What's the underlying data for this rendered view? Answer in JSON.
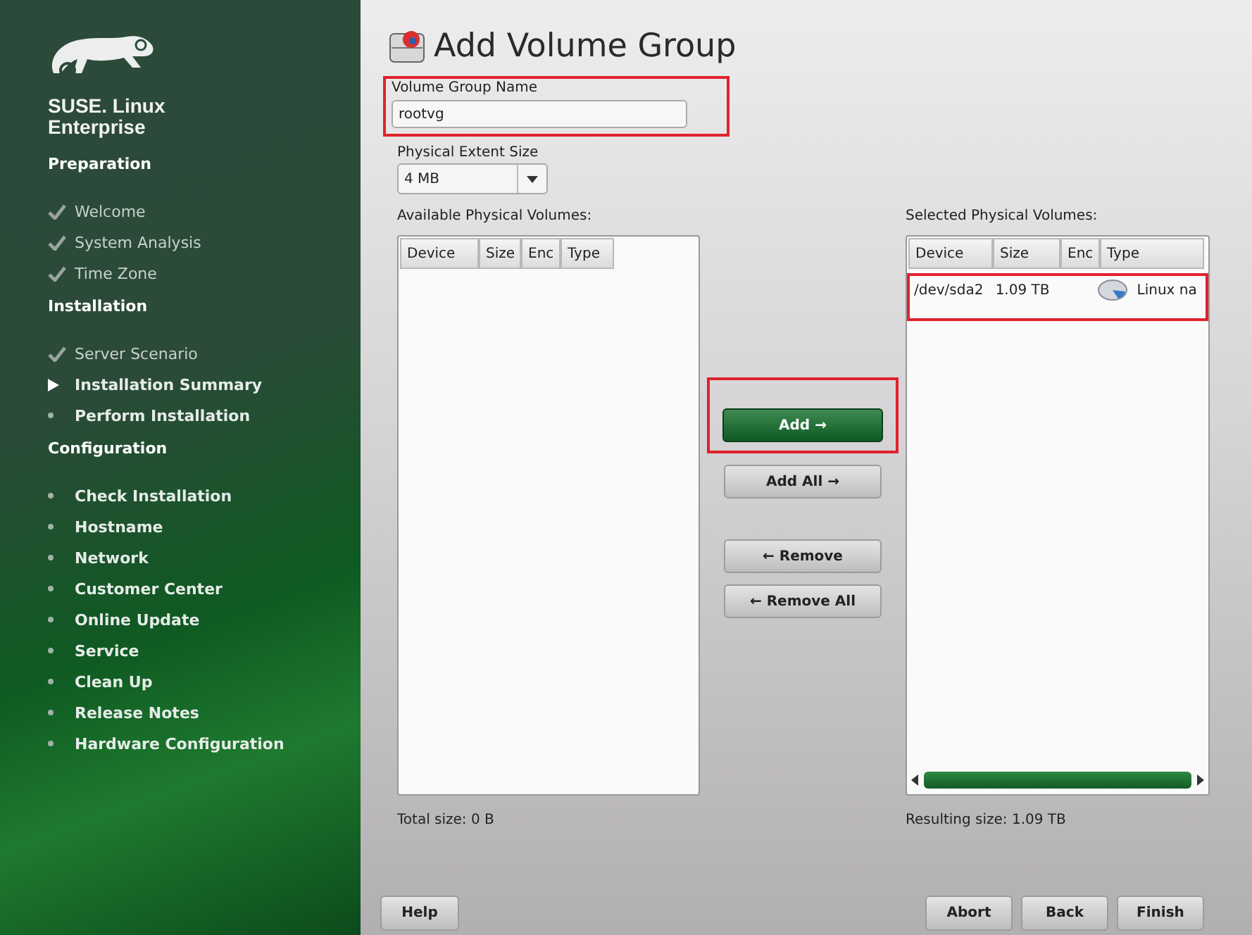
{
  "brand": {
    "line_1": "SUSE. Linux",
    "line_2": "Enterprise"
  },
  "sidebar": {
    "sections": [
      {
        "title": "Preparation",
        "items": [
          {
            "label": "Welcome",
            "kind": "done"
          },
          {
            "label": "System Analysis",
            "kind": "done"
          },
          {
            "label": "Time Zone",
            "kind": "done"
          }
        ]
      },
      {
        "title": "Installation",
        "items": [
          {
            "label": "Server Scenario",
            "kind": "done"
          },
          {
            "label": "Installation Summary",
            "kind": "current"
          },
          {
            "label": "Perform Installation",
            "kind": "pending"
          }
        ]
      },
      {
        "title": "Configuration",
        "items": [
          {
            "label": "Check Installation",
            "kind": "pending"
          },
          {
            "label": "Hostname",
            "kind": "pending"
          },
          {
            "label": "Network",
            "kind": "pending"
          },
          {
            "label": "Customer Center",
            "kind": "pending"
          },
          {
            "label": "Online Update",
            "kind": "pending"
          },
          {
            "label": "Service",
            "kind": "pending"
          },
          {
            "label": "Clean Up",
            "kind": "pending"
          },
          {
            "label": "Release Notes",
            "kind": "pending"
          },
          {
            "label": "Hardware Configuration",
            "kind": "pending"
          }
        ]
      }
    ]
  },
  "title": "Add Volume Group",
  "name_field": {
    "label": "Volume Group Name",
    "value": "rootvg",
    "highlighted": true
  },
  "extent_field": {
    "label": "Physical Extent Size",
    "value": "4 MB"
  },
  "available": {
    "label": "Available Physical Volumes:",
    "columns": [
      "Device",
      "Size",
      "Enc",
      "Type"
    ],
    "total": "Total size: 0 B"
  },
  "selected": {
    "label": "Selected Physical Volumes:",
    "columns": [
      "Device",
      "Size",
      "Enc",
      "Type"
    ],
    "rows": [
      {
        "device": "/dev/sda2",
        "size": "1.09 TB",
        "type": "Linux na",
        "highlighted": true
      }
    ],
    "total": "Resulting size: 1.09 TB"
  },
  "move_buttons": [
    {
      "label": "Add →",
      "primary": true,
      "highlighted": true
    },
    {
      "label": "Add All →",
      "primary": false,
      "highlighted": false
    },
    {
      "label": "← Remove",
      "primary": false,
      "highlighted": false
    },
    {
      "label": "← Remove All",
      "primary": false,
      "highlighted": false
    }
  ],
  "footer": {
    "help": "Help",
    "actions": [
      "Abort",
      "Back",
      "Finish"
    ]
  }
}
